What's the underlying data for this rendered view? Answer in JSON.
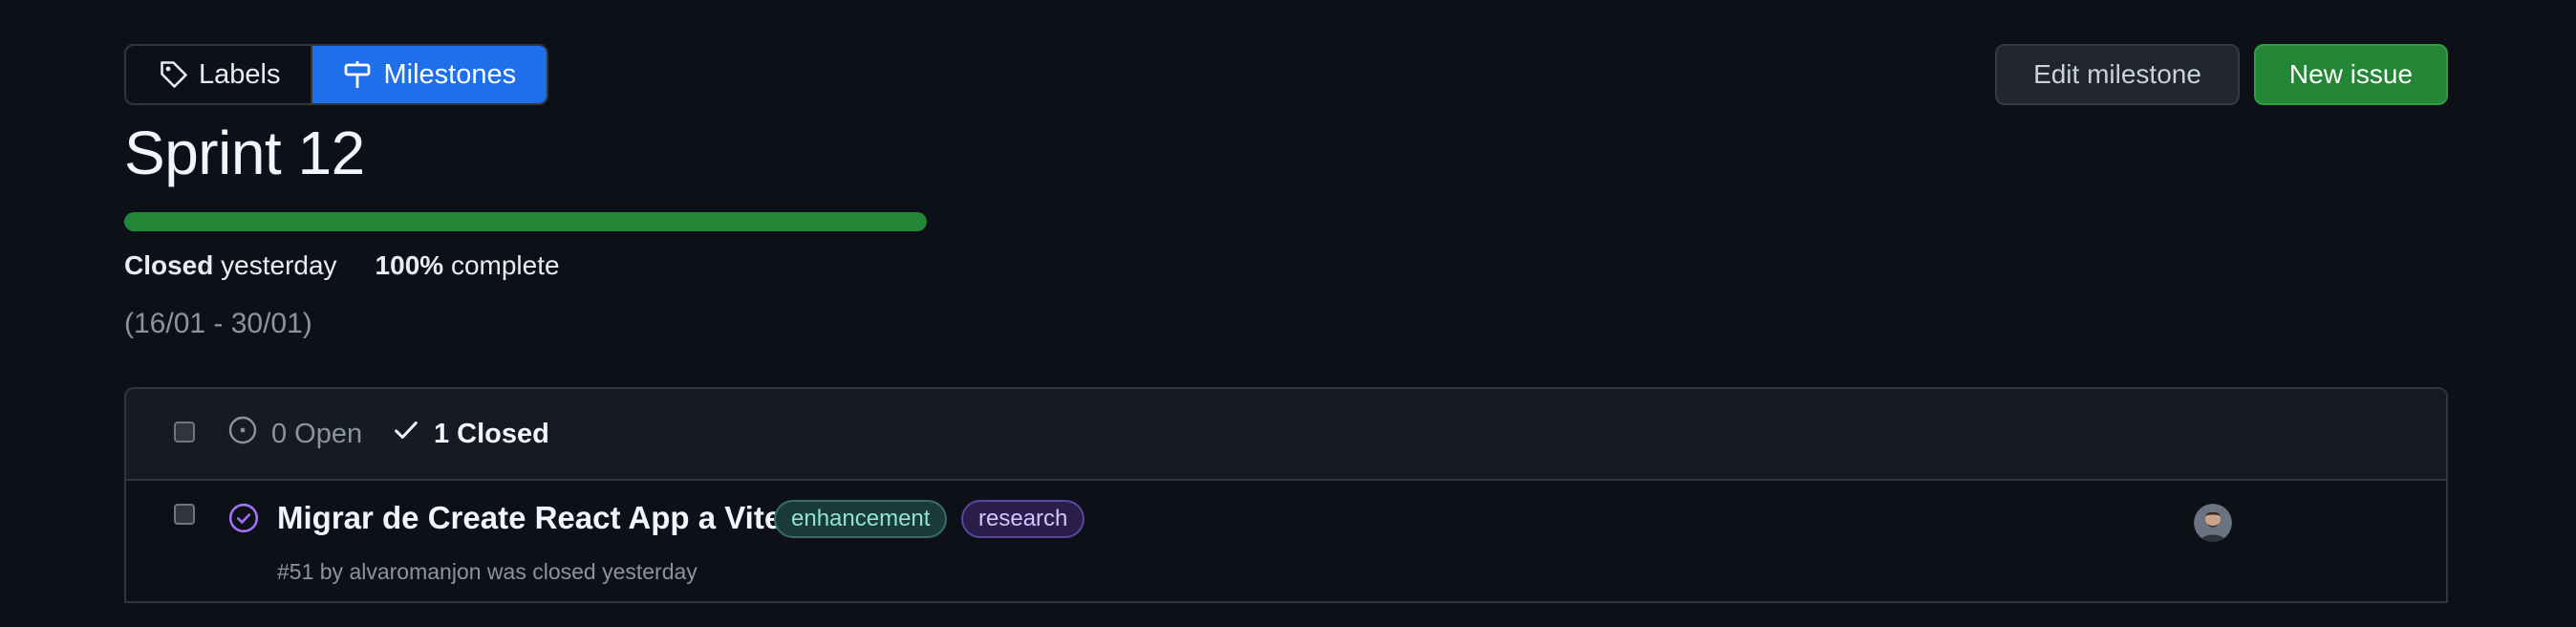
{
  "nav": {
    "labels_label": "Labels",
    "milestones_label": "Milestones"
  },
  "actions": {
    "edit_label": "Edit milestone",
    "new_issue_label": "New issue"
  },
  "milestone": {
    "title": "Sprint 12",
    "progress_fraction": 1.0,
    "closed_label": "Closed",
    "closed_when": "yesterday",
    "percent": "100%",
    "complete_label": "complete",
    "dates": "(16/01 - 30/01)"
  },
  "issues_header": {
    "open_label": "0 Open",
    "closed_label": "1 Closed"
  },
  "issues": [
    {
      "title": "Migrar de Create React App a Vite",
      "labels": [
        {
          "name": "enhancement"
        },
        {
          "name": "research"
        }
      ],
      "subtitle": "#51 by alvaromanjon was closed yesterday",
      "status": "closed"
    }
  ],
  "colors": {
    "accent_blue": "#1f6feb",
    "success_green": "#238636",
    "closed_purple": "#a371f7",
    "background": "#0d1117"
  },
  "icons": {
    "labels": "tag-icon",
    "milestones": "milestone-icon",
    "open": "issue-open-icon",
    "closed": "check-icon",
    "issue_closed": "issue-closed-icon"
  }
}
